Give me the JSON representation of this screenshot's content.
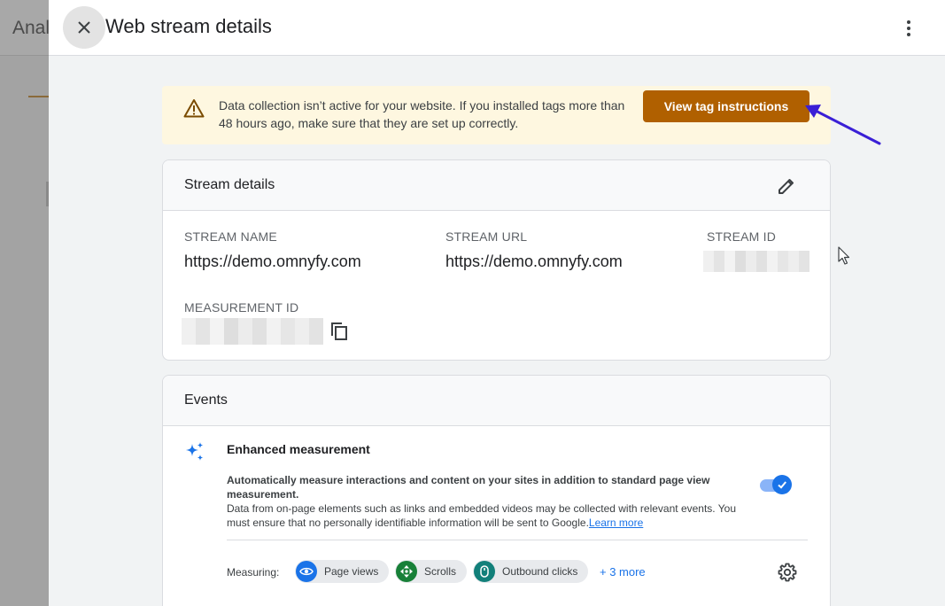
{
  "background": {
    "app_title": "Anal"
  },
  "header": {
    "title": "Web stream details",
    "close_icon": "close-icon",
    "more_icon": "more-vert-icon"
  },
  "banner": {
    "icon": "warning-icon",
    "message": "Data collection isn’t active for your website. If you installed tags more than 48 hours ago, make sure that they are set up correctly.",
    "button_label": "View tag instructions",
    "button_color": "#b06000",
    "background_color": "#fef7e0"
  },
  "stream_details": {
    "title": "Stream details",
    "edit_icon": "pencil-icon",
    "fields": {
      "stream_name_label": "STREAM NAME",
      "stream_name_value": "https://demo.omnyfy.com",
      "stream_url_label": "STREAM URL",
      "stream_url_value": "https://demo.omnyfy.com",
      "stream_id_label": "STREAM ID",
      "measurement_id_label": "MEASUREMENT ID"
    },
    "copy_icon": "copy-icon"
  },
  "events": {
    "title": "Events",
    "enhanced_measurement": {
      "icon": "sparkle-icon",
      "title": "Enhanced measurement",
      "description_bold": "Automatically measure interactions and content on your sites in addition to standard page view measurement.",
      "description": "Data from on-page elements such as links and embedded videos may be collected with relevant events. You must ensure that no personally identifiable information will be sent to Google.",
      "learn_more": "Learn more",
      "toggle_on": true
    },
    "measuring": {
      "label": "Measuring:",
      "chips": [
        {
          "label": "Page views",
          "icon": "eye-icon",
          "color": "#1a73e8"
        },
        {
          "label": "Scrolls",
          "icon": "scroll-icon",
          "color": "#188038"
        },
        {
          "label": "Outbound clicks",
          "icon": "mouse-icon",
          "color": "#12807a"
        }
      ],
      "more_link": "+ 3 more",
      "settings_icon": "gear-icon"
    }
  },
  "colors": {
    "accent": "#1a73e8",
    "annotation_arrow": "#3a1fd6"
  }
}
